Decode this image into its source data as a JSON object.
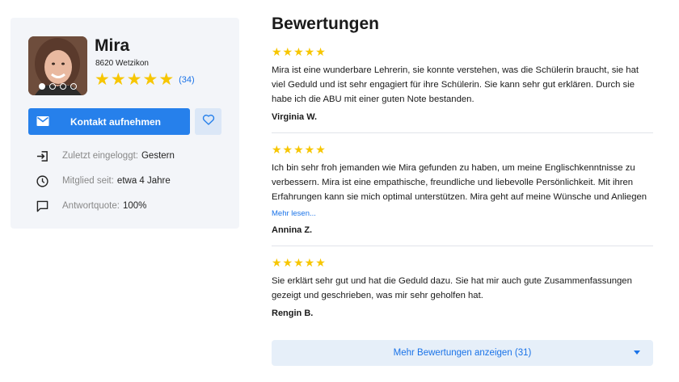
{
  "profile": {
    "name": "Mira",
    "location": "8620 Wetzikon",
    "rating_stars": 5,
    "review_count": "(34)",
    "photo_count": 4,
    "photo_active_index": 0,
    "contact_label": "Kontakt aufnehmen",
    "meta": {
      "last_login_key": "Zuletzt eingeloggt:",
      "last_login_value": "Gestern",
      "member_key": "Mitglied seit:",
      "member_value": "etwa 4 Jahre",
      "response_key": "Antwortquote:",
      "response_value": "100%"
    }
  },
  "reviews": {
    "title": "Bewertungen",
    "items": [
      {
        "stars": 5,
        "text": "Mira ist eine wunderbare Lehrerin, sie konnte verstehen, was die Schülerin braucht, sie hat viel Geduld und ist sehr engagiert für ihre Schülerin. Sie kann sehr gut erklären. Durch sie habe ich die ABU mit einer guten Note bestanden.",
        "author": "Virginia W."
      },
      {
        "stars": 5,
        "text": "Ich bin sehr froh jemanden wie Mira gefunden zu haben, um meine Englischkenntnisse zu verbessern. Mira ist eine empathische, freundliche und liebevolle Persönlichkeit. Mit ihren Erfahrungen kann sie mich optimal unterstützen. Mira geht auf meine Wünsche und Anliegen",
        "more": "Mehr lesen...",
        "author": "Annina Z."
      },
      {
        "stars": 5,
        "text": "Sie erklärt sehr gut und hat die Geduld dazu. Sie hat mir auch gute Zusammenfassungen gezeigt und geschrieben, was mir sehr geholfen hat.",
        "author": "Rengin B."
      }
    ],
    "show_more_label": "Mehr Bewertungen anzeigen (31)"
  },
  "colors": {
    "accent": "#2680eb",
    "link": "#1a73e8",
    "star": "#f7c600",
    "card_bg": "#f3f5f9",
    "show_more_bg": "#e6eff9"
  },
  "icons": {
    "contact": "mail-icon",
    "favorite": "heart-icon",
    "last_login": "login-arrow-icon",
    "member": "clock-icon",
    "response": "chat-bubble-icon",
    "show_more": "caret-down-icon"
  }
}
